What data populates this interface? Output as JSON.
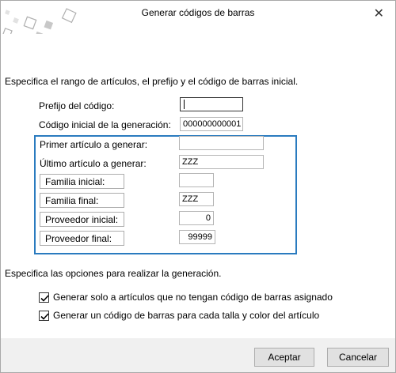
{
  "window": {
    "title": "Generar códigos de barras",
    "close_icon": "close-icon"
  },
  "intro": "Especifica el rango de artículos, el prefijo y el código de barras inicial.",
  "fields": {
    "prefijo": {
      "label": "Prefijo del código:",
      "value": ""
    },
    "codigo_inicial": {
      "label": "Código inicial de la generación:",
      "value": "000000000001"
    },
    "primer_articulo": {
      "label": "Primer artículo a generar:",
      "value": ""
    },
    "ultimo_articulo": {
      "label": "Último artículo a generar:",
      "value": "ZZZ"
    },
    "familia_inicial": {
      "label": "Familia inicial:",
      "value": ""
    },
    "familia_final": {
      "label": "Familia final:",
      "value": "ZZZ"
    },
    "proveedor_inicial": {
      "label": "Proveedor inicial:",
      "value": "0"
    },
    "proveedor_final": {
      "label": "Proveedor final:",
      "value": "99999"
    }
  },
  "options_heading": "Especifica las opciones para realizar la generación.",
  "options": [
    {
      "label": "Generar solo a artículos que no tengan código de barras asignado",
      "checked": true
    },
    {
      "label": "Generar un código de barras para cada talla y color del artículo",
      "checked": true
    }
  ],
  "buttons": {
    "accept": "Aceptar",
    "cancel": "Cancelar"
  }
}
